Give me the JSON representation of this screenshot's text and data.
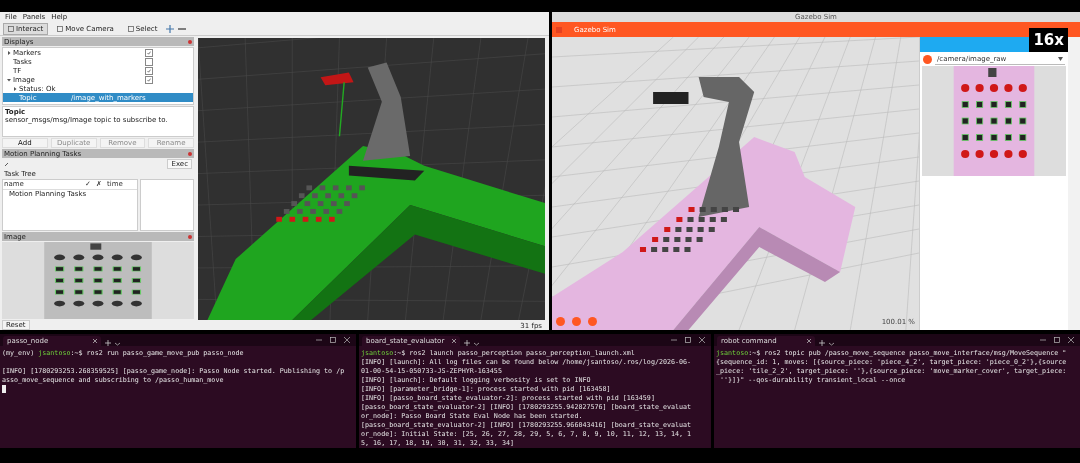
{
  "rviz": {
    "menu": [
      "File",
      "Panels",
      "Help"
    ],
    "tools": [
      {
        "label": "Interact",
        "selected": true
      },
      {
        "label": "Move Camera",
        "selected": false
      },
      {
        "label": "Select",
        "selected": false
      }
    ],
    "displays": {
      "title": "Displays",
      "items": [
        {
          "label": "Markers",
          "expanded": false,
          "checked": true,
          "selected": false
        },
        {
          "label": "Tasks",
          "checked": false,
          "selected": false
        },
        {
          "label": "TF",
          "checked": true,
          "selected": false
        },
        {
          "label": "Image",
          "checked": true,
          "expanded": true,
          "selected": false,
          "children": [
            {
              "label": "Status: Ok",
              "expanded": false,
              "selected": false
            },
            {
              "label": "Topic",
              "value": "/image_with_markers",
              "selected": true
            }
          ]
        }
      ]
    },
    "description": {
      "title": "Topic",
      "text": "sensor_msgs/msg/Image topic to subscribe to."
    },
    "buttons": [
      {
        "label": "Add",
        "disabled": false
      },
      {
        "label": "Duplicate",
        "disabled": true
      },
      {
        "label": "Remove",
        "disabled": true
      },
      {
        "label": "Rename",
        "disabled": true
      }
    ],
    "tasks_panel": {
      "title": "Motion Planning Tasks",
      "exec": "Exec",
      "tree_label": "Task Tree",
      "columns": [
        "name",
        "✓",
        "✗",
        "time"
      ],
      "rows": [
        "Motion Planning Tasks"
      ]
    },
    "image_panel": {
      "title": "Image"
    },
    "reset": "Reset",
    "fps": "31 fps"
  },
  "gazebo": {
    "window_title": "Gazebo Sim",
    "toolbar_title": "Gazebo Sim",
    "topic": "/camera/image_raw",
    "speed_badge": "16x",
    "rtf": "100.01 %"
  },
  "terminals": [
    {
      "tab": "passo_node",
      "cursor": true,
      "lines": [
        {
          "kind": "prompt",
          "env": "(my_env)",
          "user": "jsantoso",
          "sep": ":~$",
          "text": "ros2 run passo_game_move_pub passo_node"
        },
        {
          "kind": "blank"
        },
        {
          "kind": "output",
          "text": "[INFO] [1780293253.268359525] [passo_game_node]: Passo Node started. Publishing to /p"
        },
        {
          "kind": "output",
          "text": "asso_move_sequence and subscribing to /passo_human_move"
        }
      ]
    },
    {
      "tab": "board_state_evaluator",
      "cursor": false,
      "lines": [
        {
          "kind": "prompt",
          "user": "jsantoso",
          "sep": ":~$",
          "text": "ros2 launch passo_perception passo_perception_launch.xml"
        },
        {
          "kind": "output",
          "text": "[INFO] [launch]: All log files can be found below /home/jsantoso/.ros/log/2026-06-"
        },
        {
          "kind": "output",
          "text": "01-00-54-15-050733-JS-ZEPHYR-163455"
        },
        {
          "kind": "output",
          "text": "[INFO] [launch]: Default logging verbosity is set to INFO"
        },
        {
          "kind": "output",
          "text": "[INFO] [parameter_bridge-1]: process started with pid [163458]"
        },
        {
          "kind": "output",
          "text": "[INFO] [passo_board_state_evaluator-2]: process started with pid [163459]"
        },
        {
          "kind": "output",
          "text": "[passo_board_state_evaluator-2] [INFO] [1780293255.942827576] [board_state_evaluat"
        },
        {
          "kind": "output",
          "text": "or_node]: Passo Board State Eval Node has been started."
        },
        {
          "kind": "output",
          "text": "[passo_board_state_evaluator-2] [INFO] [1780293255.966043416] [board_state_evaluat"
        },
        {
          "kind": "output",
          "text": "or_node]: Initial State: [25, 26, 27, 28, 29, 5, 6, 7, 8, 9, 10, 11, 12, 13, 14, 1"
        },
        {
          "kind": "output",
          "text": "5, 16, 17, 18, 19, 30, 31, 32, 33, 34]"
        }
      ]
    },
    {
      "tab": "robot command",
      "cursor": false,
      "lines": [
        {
          "kind": "prompt",
          "user": "jsantoso",
          "sep": ":~$",
          "text": "ros2 topic pub /passo_move_sequence passo_move_interface/msg/MoveSequence \""
        },
        {
          "kind": "output",
          "text": "{sequence_id: 1, moves: [{source_piece: 'piece_4_2', target_piece: 'piece_0_2'},{source"
        },
        {
          "kind": "output",
          "text": "_piece: 'tile_2_2', target_piece: ''},{source_piece: 'move_marker_cover', target_piece:"
        },
        {
          "kind": "output",
          "text": " ''}]}\" --qos-durability transient_local --once"
        }
      ]
    }
  ]
}
